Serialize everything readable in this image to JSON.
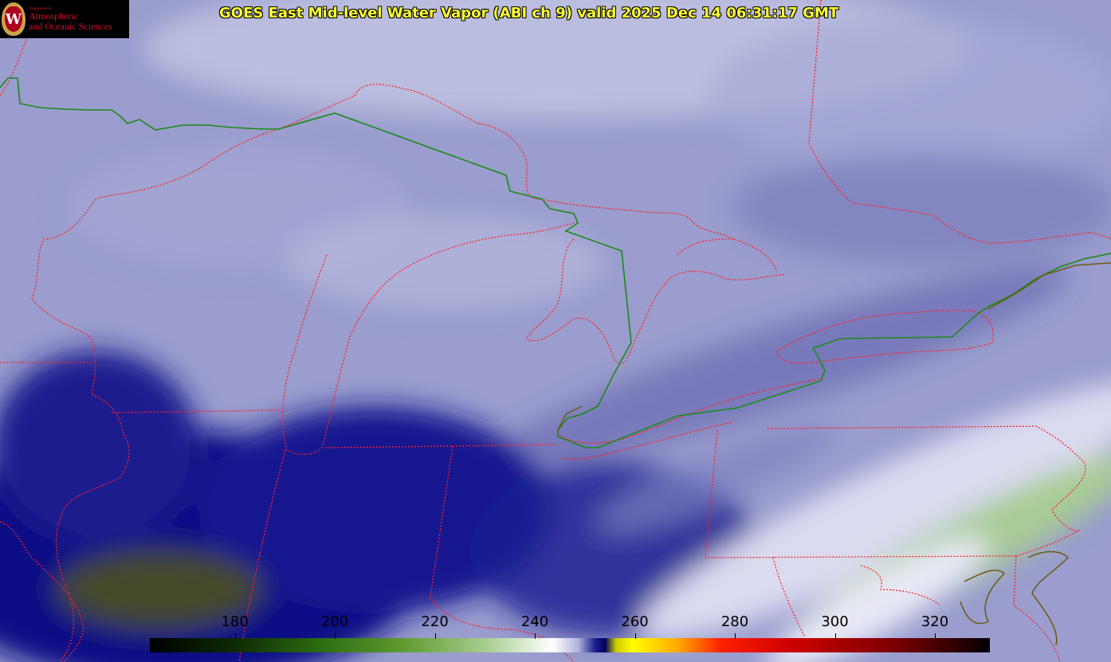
{
  "header": {
    "title": "GOES East Mid-level Water Vapor (ABI ch 9)  valid 2025 Dec 14 06:31:17 GMT"
  },
  "logo": {
    "small_text": "Department of",
    "line1": "Atmospheric",
    "line2": "and Oceanic Sciences",
    "seal_letter": "W"
  },
  "colorbar": {
    "ticks": [
      "180",
      "200",
      "220",
      "240",
      "260",
      "280",
      "300",
      "320"
    ],
    "tick_values": [
      180,
      200,
      220,
      240,
      260,
      280,
      300,
      320
    ],
    "range": [
      163,
      331
    ]
  },
  "colors": {
    "state_borders": "#ff2020",
    "international_border": "#1a8a1a",
    "title": "#ffff33"
  }
}
